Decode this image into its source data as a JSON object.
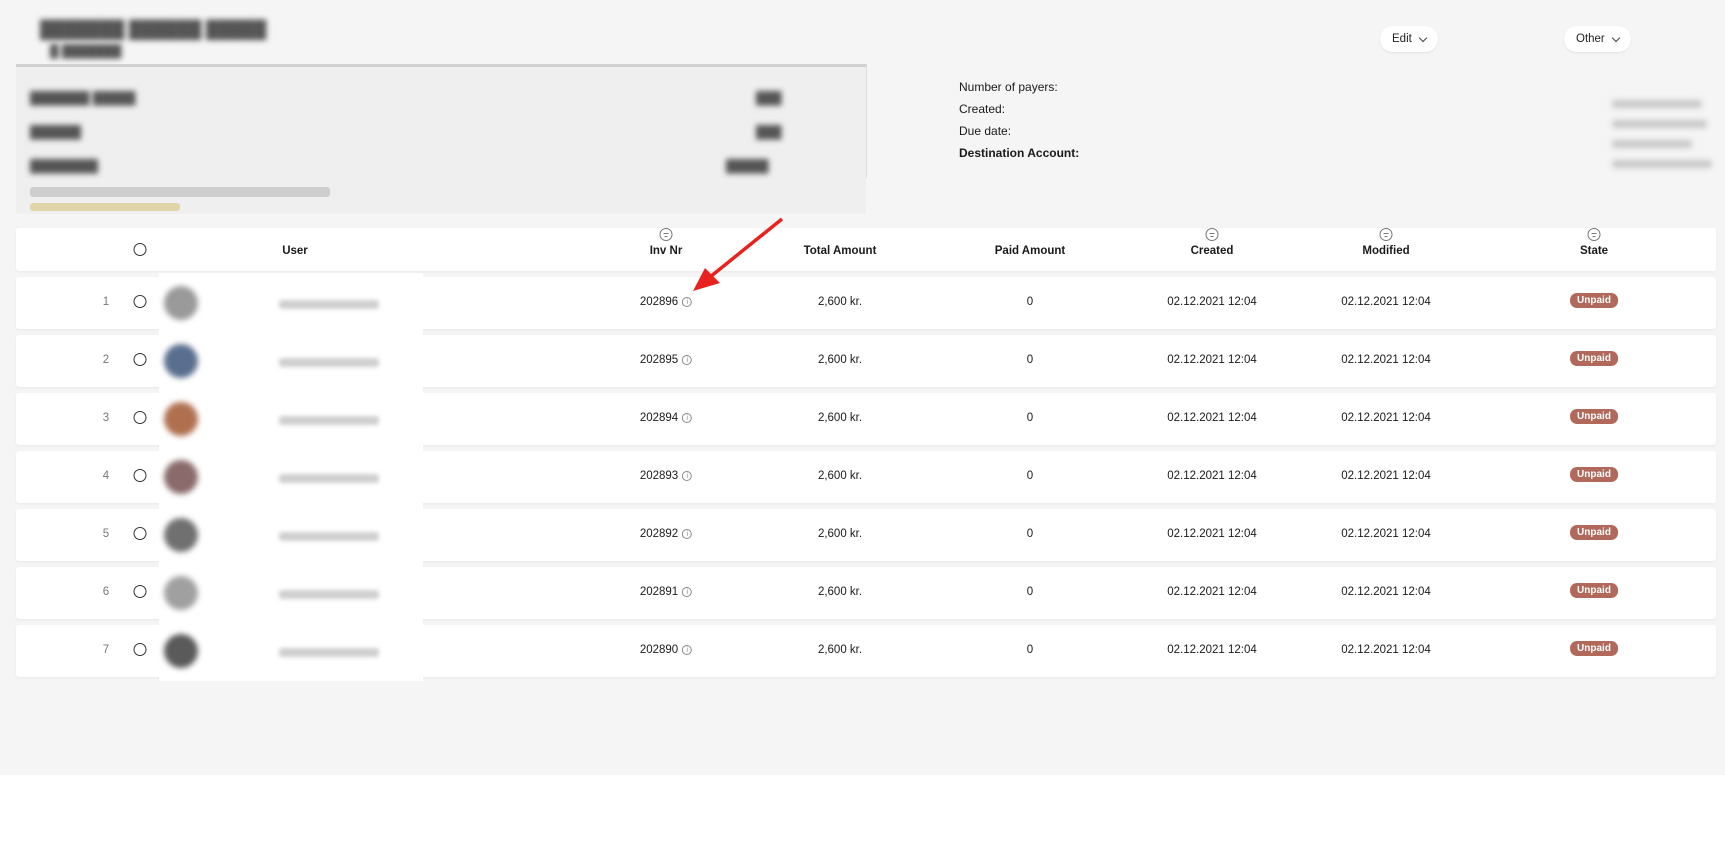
{
  "header": {
    "edit_label": "Edit",
    "other_label": "Other"
  },
  "meta": {
    "payers_label": "Number of payers:",
    "created_label": "Created:",
    "due_label": "Due date:",
    "destination_label": "Destination Account:"
  },
  "table": {
    "headers": {
      "user": "User",
      "inv_nr": "Inv Nr",
      "total": "Total Amount",
      "paid": "Paid Amount",
      "created": "Created",
      "modified": "Modified",
      "state": "State"
    },
    "rows": [
      {
        "index": "1",
        "inv": "202896",
        "total": "2,600 kr.",
        "paid": "0",
        "created": "02.12.2021 12:04",
        "modified": "02.12.2021 12:04",
        "state": "Unpaid",
        "avatar_color": "#9a9a9a"
      },
      {
        "index": "2",
        "inv": "202895",
        "total": "2,600 kr.",
        "paid": "0",
        "created": "02.12.2021 12:04",
        "modified": "02.12.2021 12:04",
        "state": "Unpaid",
        "avatar_color": "#5a6f8f"
      },
      {
        "index": "3",
        "inv": "202894",
        "total": "2,600 kr.",
        "paid": "0",
        "created": "02.12.2021 12:04",
        "modified": "02.12.2021 12:04",
        "state": "Unpaid",
        "avatar_color": "#b07050"
      },
      {
        "index": "4",
        "inv": "202893",
        "total": "2,600 kr.",
        "paid": "0",
        "created": "02.12.2021 12:04",
        "modified": "02.12.2021 12:04",
        "state": "Unpaid",
        "avatar_color": "#8a6a6a"
      },
      {
        "index": "5",
        "inv": "202892",
        "total": "2,600 kr.",
        "paid": "0",
        "created": "02.12.2021 12:04",
        "modified": "02.12.2021 12:04",
        "state": "Unpaid",
        "avatar_color": "#707070"
      },
      {
        "index": "6",
        "inv": "202891",
        "total": "2,600 kr.",
        "paid": "0",
        "created": "02.12.2021 12:04",
        "modified": "02.12.2021 12:04",
        "state": "Unpaid",
        "avatar_color": "#a0a0a0"
      },
      {
        "index": "7",
        "inv": "202890",
        "total": "2,600 kr.",
        "paid": "0",
        "created": "02.12.2021 12:04",
        "modified": "02.12.2021 12:04",
        "state": "Unpaid",
        "avatar_color": "#5a5a5a"
      }
    ]
  },
  "colors": {
    "unpaid_badge": "#b0695a",
    "annotation_arrow": "#e8231f"
  },
  "icons": [
    "chevron-down-icon",
    "filter-icon",
    "info-icon",
    "radio-icon",
    "arrow-annotation"
  ]
}
